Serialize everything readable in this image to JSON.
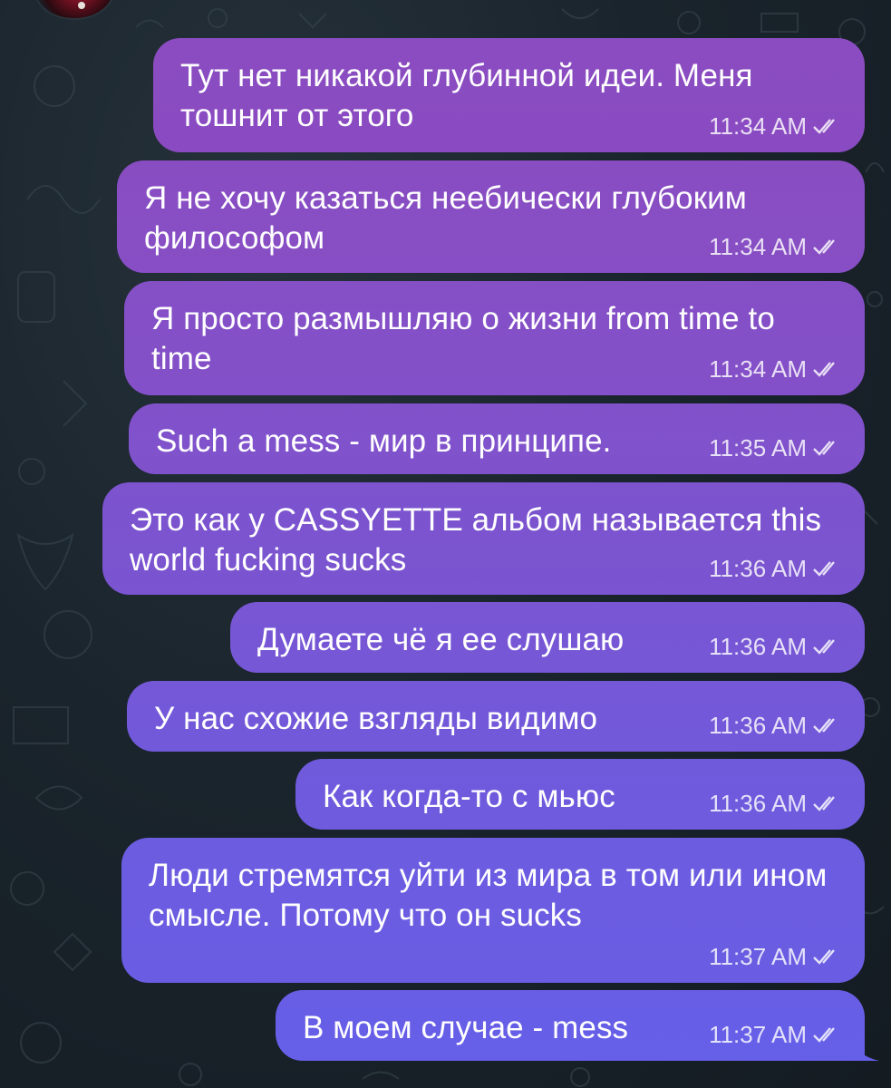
{
  "chat": {
    "messages": [
      {
        "text": "Тут нет никакой глубинной идеи. Меня тошнит от этого",
        "time": "11:34 AM"
      },
      {
        "text": "Я не хочу казаться неебически глубоким философом",
        "time": "11:34 AM"
      },
      {
        "text": "Я просто размышляю о жизни from time to time",
        "time": "11:34 AM"
      },
      {
        "text": "Such a mess - мир в принципе.",
        "time": "11:35 AM"
      },
      {
        "text": "Это как у CASSYETTE альбом называется this world fucking sucks",
        "time": "11:36 AM"
      },
      {
        "text": "Думаете чё я ее слушаю",
        "time": "11:36 AM"
      },
      {
        "text": "У нас схожие взгляды видимо",
        "time": "11:36 AM"
      },
      {
        "text": "Как когда-то с мьюс",
        "time": "11:36 AM"
      },
      {
        "text": "Люди стремятся уйти из мира в том или ином смысле. Потому что он sucks",
        "time": "11:37 AM"
      },
      {
        "text": "В моем случае - mess",
        "time": "11:37 AM"
      }
    ],
    "read_status_icon": "double-check-icon"
  },
  "colors": {
    "background": "#1a242c",
    "bubble_top": "#8a4cc0",
    "bubble_bottom": "#6a58e8",
    "text": "#ffffff"
  }
}
